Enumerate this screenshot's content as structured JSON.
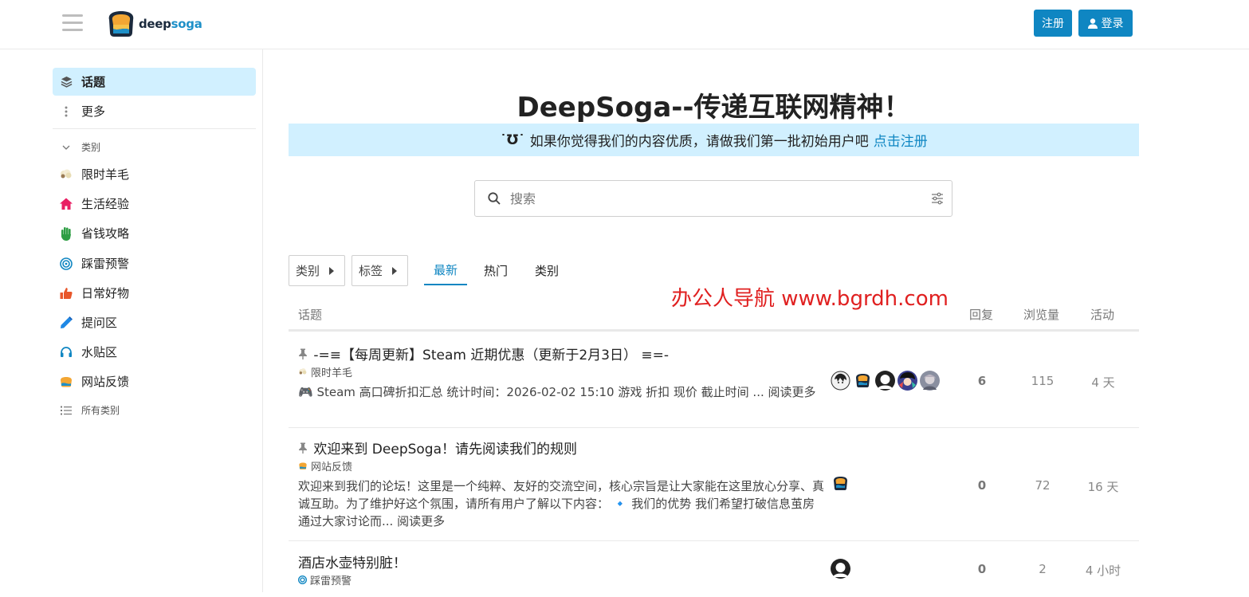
{
  "header": {
    "logo_deep": "deep",
    "logo_soga": "soga",
    "register_label": "注册",
    "login_label": "登录"
  },
  "sidebar": {
    "topics": "话题",
    "more": "更多",
    "categories_heading": "类别",
    "categories": [
      {
        "label": "限时羊毛"
      },
      {
        "label": "生活经验"
      },
      {
        "label": "省钱攻略"
      },
      {
        "label": "踩雷预警"
      },
      {
        "label": "日常好物"
      },
      {
        "label": "提问区"
      },
      {
        "label": "水贴区"
      },
      {
        "label": "网站反馈"
      }
    ],
    "all_categories": "所有类别"
  },
  "banner": {
    "title": "DeepSoga--传递互联网精神！",
    "emoji": "˙Ʊ˙",
    "subtitle": "如果你觉得我们的内容优质，请做我们第一批初始用户吧",
    "link": "点击注册"
  },
  "search": {
    "placeholder": "搜索"
  },
  "nav": {
    "categories_dropdown": "类别",
    "tags_dropdown": "标签",
    "tabs": [
      "最新",
      "热门",
      "类别"
    ]
  },
  "watermark": "办公人导航  www.bgrdh.com",
  "table": {
    "headers": {
      "topic": "话题",
      "replies": "回复",
      "views": "浏览量",
      "activity": "活动"
    },
    "rows": [
      {
        "title": "-=≡【每周更新】Steam 近期优惠（更新于2月3日） ≡=-",
        "category": "限时羊毛",
        "excerpt": "🎮 Steam 高口碑折扣汇总 统计时间：2026-02-02 15:10 游戏 折扣 现价 截止时间 ...",
        "read_more": "阅读更多",
        "replies": "6",
        "views": "115",
        "activity": "4 天"
      },
      {
        "title": "欢迎来到 DeepSoga！请先阅读我们的规则",
        "category": "网站反馈",
        "excerpt": "欢迎来到我们的论坛！这里是一个纯粹、友好的交流空间，核心宗旨是让大家能在这里放心分享、真诚互助。为了维护好这个氛围，请所有用户了解以下内容： 🔹 我们的优势 我们希望打破信息茧房 通过大家讨论而...",
        "read_more": "阅读更多",
        "replies": "0",
        "views": "72",
        "activity": "16 天"
      },
      {
        "title": "酒店水壶特别脏！",
        "category": "踩雷预警",
        "replies": "0",
        "views": "2",
        "activity": "4 小时"
      }
    ]
  },
  "colors": {
    "primary": "#0f86c2",
    "highlight": "#d1f0ff",
    "watermark": "#e02020"
  }
}
